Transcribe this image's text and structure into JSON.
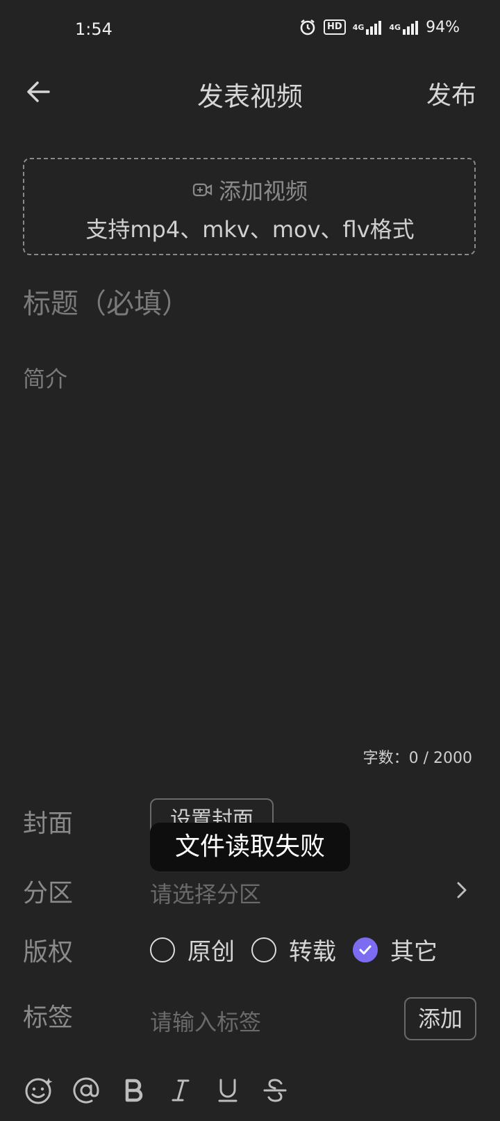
{
  "status_bar": {
    "time": "1:54",
    "hd_label": "HD",
    "net1": "4G",
    "net2": "4G",
    "battery": "94%"
  },
  "header": {
    "title": "发表视频",
    "publish_label": "发布"
  },
  "upload": {
    "add_label": "添加视频",
    "formats_text": "支持mp4、mkv、mov、flv格式"
  },
  "form": {
    "title_placeholder": "标题（必填）",
    "intro_placeholder": "简介",
    "char_count": "字数：0 / 2000",
    "cover_label": "封面",
    "cover_button": "设置封面",
    "category_label": "分区",
    "category_placeholder": "请选择分区",
    "copyright_label": "版权",
    "copyright_options": [
      {
        "label": "原创",
        "selected": false
      },
      {
        "label": "转载",
        "selected": false
      },
      {
        "label": "其它",
        "selected": true
      }
    ],
    "tags_label": "标签",
    "tags_placeholder": "请输入标签",
    "tags_add_button": "添加"
  },
  "toast": {
    "message": "文件读取失败"
  },
  "toolbar": {
    "icons": [
      "emoji-icon",
      "mention-icon",
      "bold-icon",
      "italic-icon",
      "underline-icon",
      "strikethrough-icon"
    ]
  },
  "colors": {
    "background": "#232323",
    "accent": "#7b6cf2",
    "toast_bg": "#0e0e0e"
  }
}
